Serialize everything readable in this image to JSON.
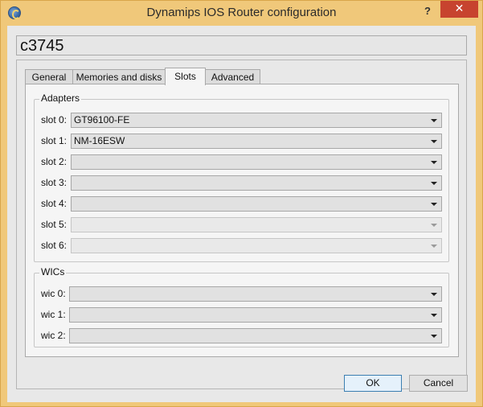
{
  "window": {
    "title": "Dynamips IOS Router configuration",
    "help_label": "?",
    "close_label": "✕"
  },
  "header": {
    "title": "c3745"
  },
  "tabs": [
    {
      "label": "General",
      "active": false
    },
    {
      "label": "Memories and disks",
      "active": false
    },
    {
      "label": "Slots",
      "active": true
    },
    {
      "label": "Advanced",
      "active": false
    }
  ],
  "adapters": {
    "title": "Adapters",
    "slots": [
      {
        "label": "slot 0:",
        "value": "GT96100-FE",
        "enabled": true
      },
      {
        "label": "slot 1:",
        "value": "NM-16ESW",
        "enabled": true
      },
      {
        "label": "slot 2:",
        "value": "",
        "enabled": true
      },
      {
        "label": "slot 3:",
        "value": "",
        "enabled": true
      },
      {
        "label": "slot 4:",
        "value": "",
        "enabled": true
      },
      {
        "label": "slot 5:",
        "value": "",
        "enabled": false
      },
      {
        "label": "slot 6:",
        "value": "",
        "enabled": false
      }
    ]
  },
  "wics": {
    "title": "WICs",
    "slots": [
      {
        "label": "wic 0:",
        "value": ""
      },
      {
        "label": "wic 1:",
        "value": ""
      },
      {
        "label": "wic 2:",
        "value": ""
      }
    ]
  },
  "buttons": {
    "ok": "OK",
    "cancel": "Cancel"
  }
}
